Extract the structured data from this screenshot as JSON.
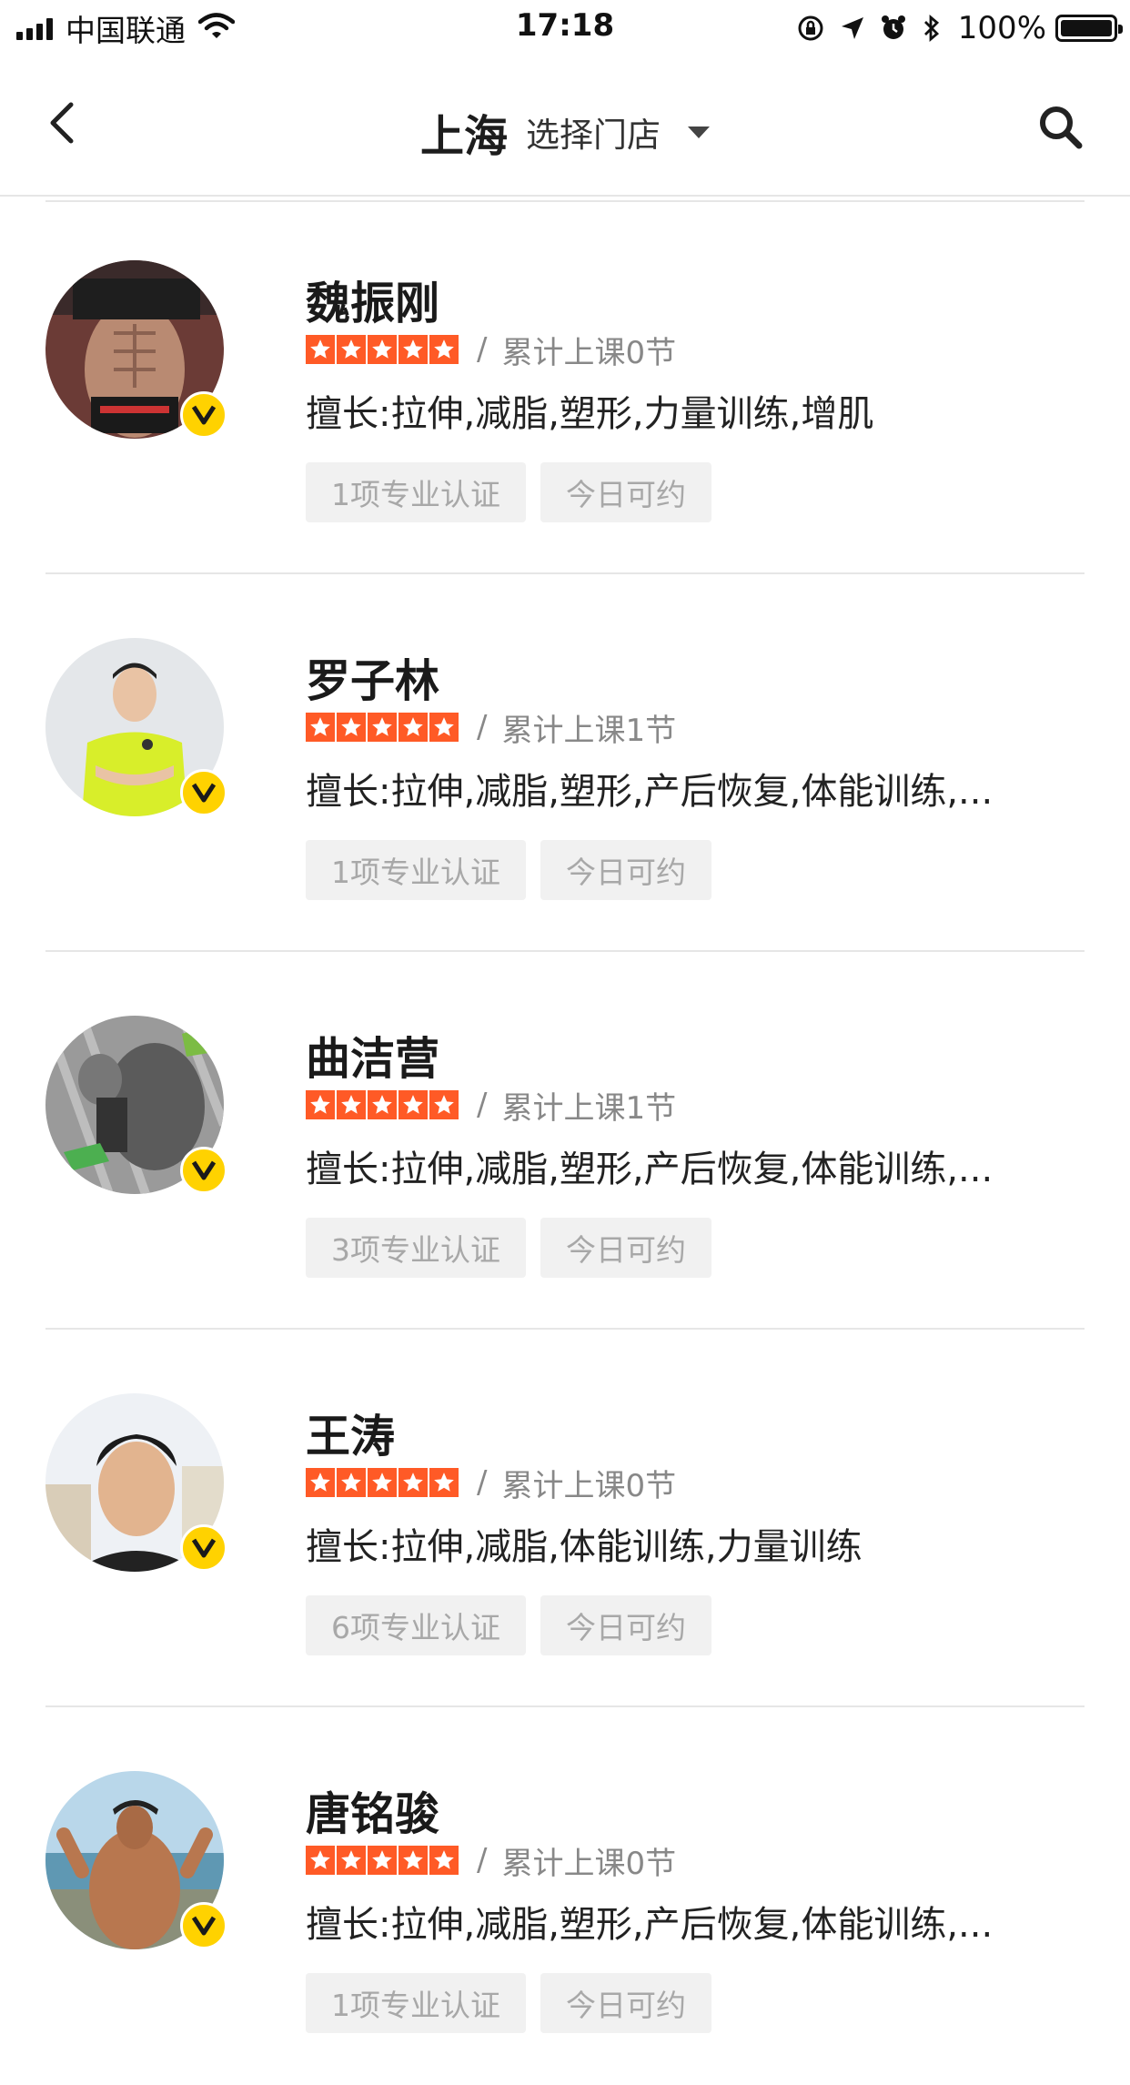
{
  "status_bar": {
    "carrier": "中国联通",
    "time": "17:18",
    "battery_percent": "100%",
    "battery_level": 1.0,
    "icons": [
      "signal-icon",
      "wifi-icon",
      "orientation-lock-icon",
      "location-icon",
      "alarm-icon",
      "bluetooth-icon",
      "battery-icon"
    ]
  },
  "nav": {
    "city": "上海",
    "store_placeholder": "选择门店",
    "back_icon": "chevron-left-icon",
    "search_icon": "search-icon"
  },
  "colors": {
    "star": "#ff5a26",
    "badge": "#ffd200",
    "tag_bg": "#f1f1f1",
    "tag_text": "#a8a8a8",
    "muted_text": "#888888"
  },
  "coaches": [
    {
      "name": "魏振刚",
      "rating_stars": 5,
      "separator": "/",
      "lessons": "累计上课0节",
      "specialty": "擅长:拉伸,减脂,塑形,力量训练,增肌",
      "cert_tag": "1项专业认证",
      "availability_tag": "今日可约",
      "badge": "V"
    },
    {
      "name": "罗子林",
      "rating_stars": 5,
      "separator": "/",
      "lessons": "累计上课1节",
      "specialty": "擅长:拉伸,减脂,塑形,产后恢复,体能训练,...",
      "cert_tag": "1项专业认证",
      "availability_tag": "今日可约",
      "badge": "V"
    },
    {
      "name": "曲洁营",
      "rating_stars": 5,
      "separator": "/",
      "lessons": "累计上课1节",
      "specialty": "擅长:拉伸,减脂,塑形,产后恢复,体能训练,...",
      "cert_tag": "3项专业认证",
      "availability_tag": "今日可约",
      "badge": "V"
    },
    {
      "name": "王涛",
      "rating_stars": 5,
      "separator": "/",
      "lessons": "累计上课0节",
      "specialty": "擅长:拉伸,减脂,体能训练,力量训练",
      "cert_tag": "6项专业认证",
      "availability_tag": "今日可约",
      "badge": "V"
    },
    {
      "name": "唐铭骏",
      "rating_stars": 5,
      "separator": "/",
      "lessons": "累计上课0节",
      "specialty": "擅长:拉伸,减脂,塑形,产后恢复,体能训练,...",
      "cert_tag": "1项专业认证",
      "availability_tag": "今日可约",
      "badge": "V"
    }
  ]
}
